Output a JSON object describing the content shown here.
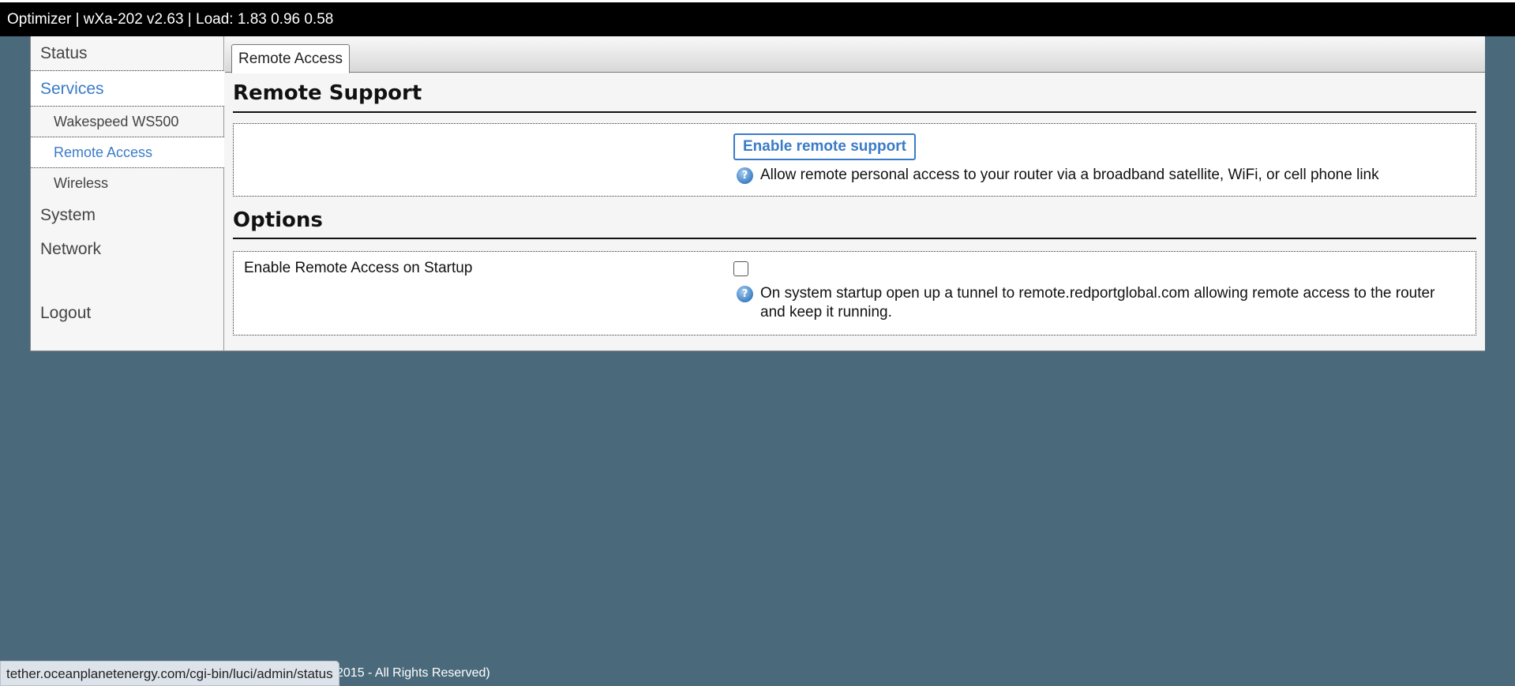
{
  "header": {
    "title": "Optimizer | wXa-202 v2.63 | Load: 1.83 0.96 0.58"
  },
  "sidebar": {
    "items": [
      {
        "label": "Status"
      },
      {
        "label": "Services"
      },
      {
        "label": "Wakespeed WS500"
      },
      {
        "label": "Remote Access"
      },
      {
        "label": "Wireless"
      },
      {
        "label": "System"
      },
      {
        "label": "Network"
      },
      {
        "label": "Logout"
      }
    ],
    "active_section": "Services",
    "active_item": "Remote Access"
  },
  "tabs": [
    {
      "label": "Remote Access",
      "active": true
    }
  ],
  "remote_support": {
    "heading": "Remote Support",
    "button_label": "Enable remote support",
    "help_text": "Allow remote personal access to your router via a broadband satellite, WiFi, or cell phone link"
  },
  "options": {
    "heading": "Options",
    "startup_label": "Enable Remote Access on Startup",
    "startup_checked": false,
    "help_text": "On system startup open up a tunnel to remote.redportglobal.com allowing remote access to the router and keep it running."
  },
  "footer": {
    "copyright": "C 2015 - All Rights Reserved)"
  },
  "status_bar": {
    "url": "tether.oceanplanetenergy.com/cgi-bin/luci/admin/status"
  },
  "colors": {
    "header_bg": "#000000",
    "page_bg": "#4a6a7c",
    "accent": "#3a7bc8"
  },
  "icons": {
    "help": "help-icon"
  }
}
